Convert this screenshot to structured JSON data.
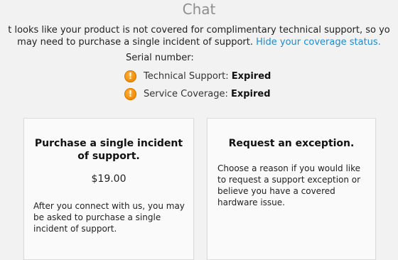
{
  "header": {
    "title": "Chat"
  },
  "message": {
    "line1": "t looks like your product is not covered for complimentary technical support, so yo",
    "line2_text": "may need to purchase a single incident of support.",
    "hide_link": "Hide your coverage status."
  },
  "coverage": {
    "serial_label": "Serial number:",
    "items": [
      {
        "label": "Technical Support:",
        "status": "Expired",
        "icon": "warning-icon"
      },
      {
        "label": "Service Coverage:",
        "status": "Expired",
        "icon": "warning-icon"
      }
    ]
  },
  "options": {
    "purchase": {
      "title": "Purchase a single incident of support.",
      "price": "$19.00",
      "description": "After you connect with us, you may be asked to purchase a single incident of support."
    },
    "exception": {
      "title": "Request an exception.",
      "description": "Choose a reason if you would like to request a support exception or believe you have a covered hardware issue."
    }
  },
  "colors": {
    "link": "#1a8bd1",
    "warning": "#f08a00"
  }
}
